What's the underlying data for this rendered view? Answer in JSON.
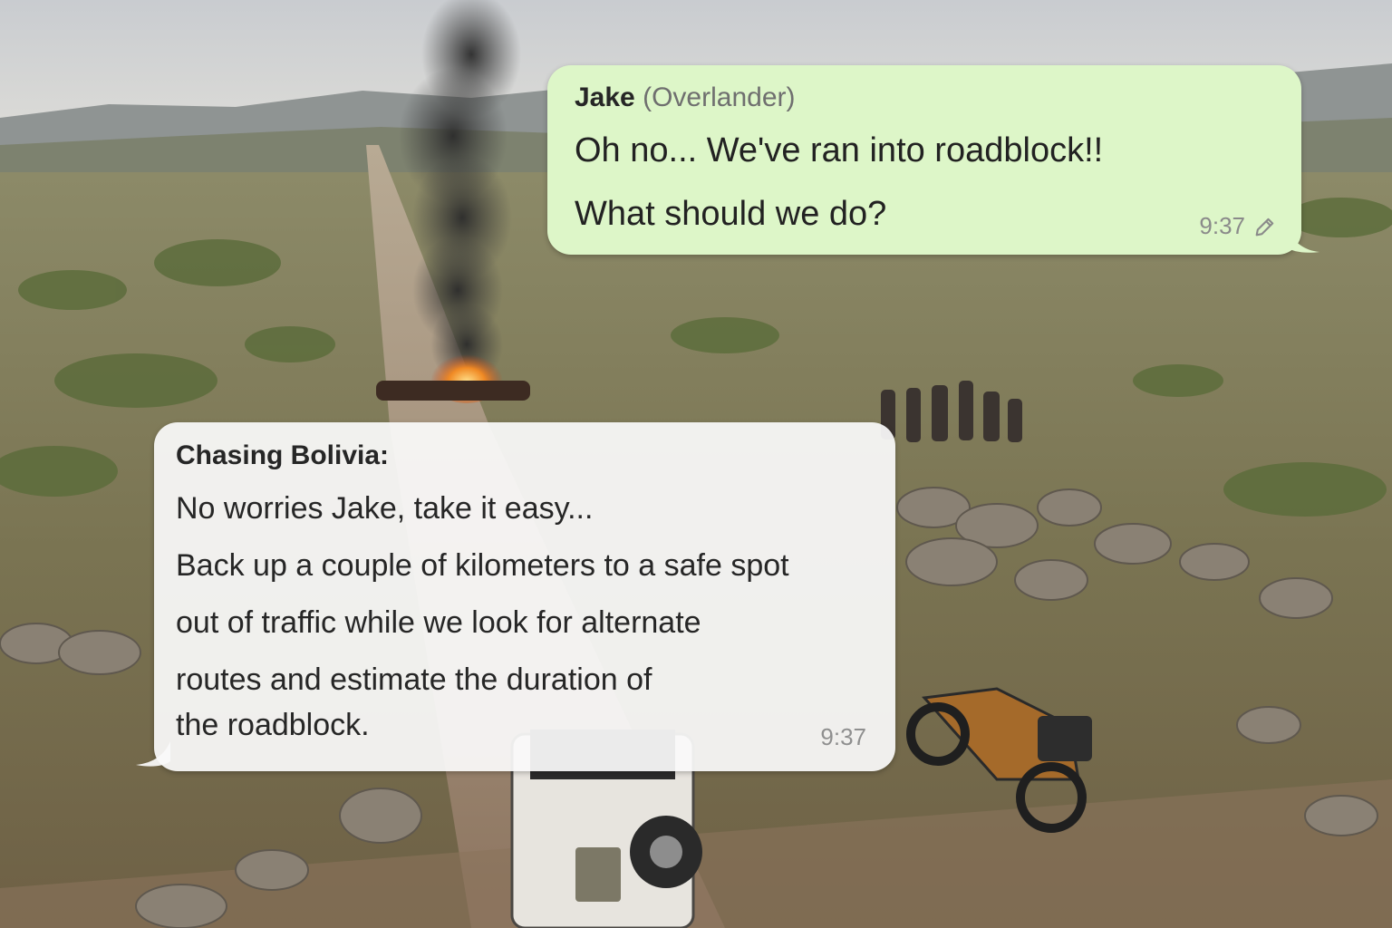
{
  "chat": {
    "outgoing": {
      "sender_name": "Jake",
      "sender_role": "(Overlander)",
      "lines": [
        "Oh no... We've ran into roadblock!!",
        "What should we do?"
      ],
      "time": "9:37",
      "edited_icon": "pencil-edit-icon",
      "bubble_color": "#ddf6c8"
    },
    "incoming": {
      "sender_name": "Chasing Bolivia:",
      "lines": [
        "No worries Jake, take it easy...",
        "Back up a couple of kilometers to a safe spot",
        "out of traffic while we look for alternate",
        "routes and estimate the duration of",
        "the roadblock."
      ],
      "time": "9:37",
      "bubble_color": "#fafafa"
    }
  },
  "background": {
    "scene": "aerial-road-roadblock-photo"
  }
}
